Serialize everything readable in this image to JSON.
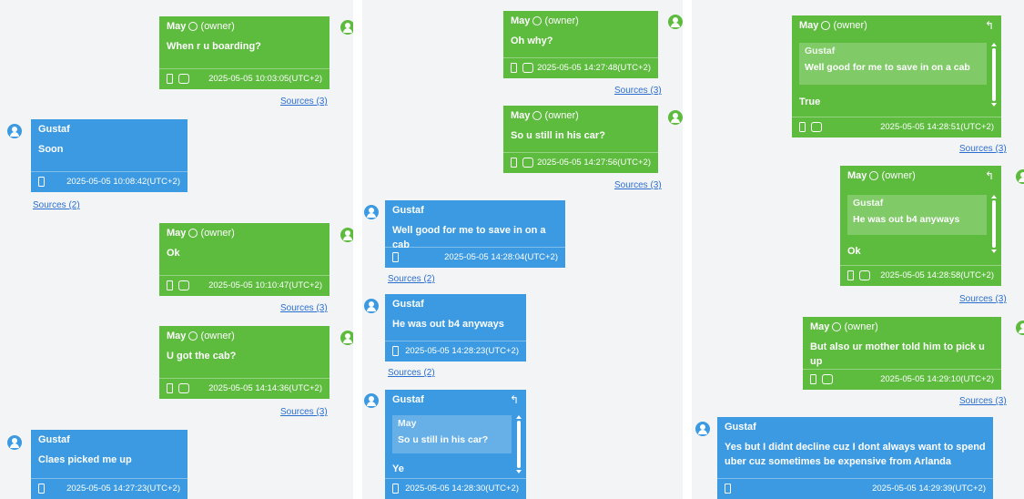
{
  "labels": {
    "owner_sender": "May",
    "owner_tag": "(owner)",
    "other_sender": "Gustaf",
    "reply_icon": "↰"
  },
  "colors": {
    "owner_bubble": "#5dbb3e",
    "other_bubble": "#3b9ae1",
    "link": "#2a6ecf",
    "panel_bg": "#f3f4f6"
  },
  "icons": [
    "contact-icon",
    "avatar-icon",
    "phone-icon",
    "group-icon",
    "reply-icon"
  ],
  "messages": {
    "c1m1": {
      "text": "When r u boarding?",
      "ts": "2025-05-05 10:03:05(UTC+2)",
      "src": "Sources (3)"
    },
    "c1m2": {
      "text": "Soon",
      "ts": "2025-05-05 10:08:42(UTC+2)",
      "src": "Sources (2)"
    },
    "c1m3": {
      "text": "Ok",
      "ts": "2025-05-05 10:10:47(UTC+2)",
      "src": "Sources (3)"
    },
    "c1m4": {
      "text": "U got the cab?",
      "ts": "2025-05-05 14:14:36(UTC+2)",
      "src": "Sources (3)"
    },
    "c1m5": {
      "text": "Claes picked me up",
      "ts": "2025-05-05 14:27:23(UTC+2)"
    },
    "c2m1": {
      "text": "Oh why?",
      "ts": "2025-05-05 14:27:48(UTC+2)",
      "src": "Sources (3)"
    },
    "c2m2": {
      "text": "So u still in his car?",
      "ts": "2025-05-05 14:27:56(UTC+2)",
      "src": "Sources (3)"
    },
    "c2m3": {
      "text": "Well good for me to save in on a cab",
      "ts": "2025-05-05 14:28:04(UTC+2)",
      "src": "Sources (2)"
    },
    "c2m4": {
      "text": "He was out b4 anyways",
      "ts": "2025-05-05 14:28:23(UTC+2)",
      "src": "Sources (2)"
    },
    "c2m5": {
      "quote_sender": "May",
      "quote_text": "So u still in his car?",
      "text": "Ye",
      "ts": "2025-05-05 14:28:30(UTC+2)"
    },
    "c3m1": {
      "quote_sender": "Gustaf",
      "quote_text": "Well good for me to save in on a cab",
      "text": "True",
      "ts": "2025-05-05 14:28:51(UTC+2)",
      "src": "Sources (3)"
    },
    "c3m2": {
      "quote_sender": "Gustaf",
      "quote_text": "He was out b4 anyways",
      "text": "Ok",
      "ts": "2025-05-05 14:28:58(UTC+2)",
      "src": "Sources (3)"
    },
    "c3m3": {
      "text": "But also ur mother told him to pick u up",
      "ts": "2025-05-05 14:29:10(UTC+2)",
      "src": "Sources (3)"
    },
    "c3m4": {
      "text": "Yes but I didnt decline cuz I dont always want to spend uber cuz sometimes be expensive from Arlanda",
      "ts": "2025-05-05 14:29:39(UTC+2)"
    }
  }
}
